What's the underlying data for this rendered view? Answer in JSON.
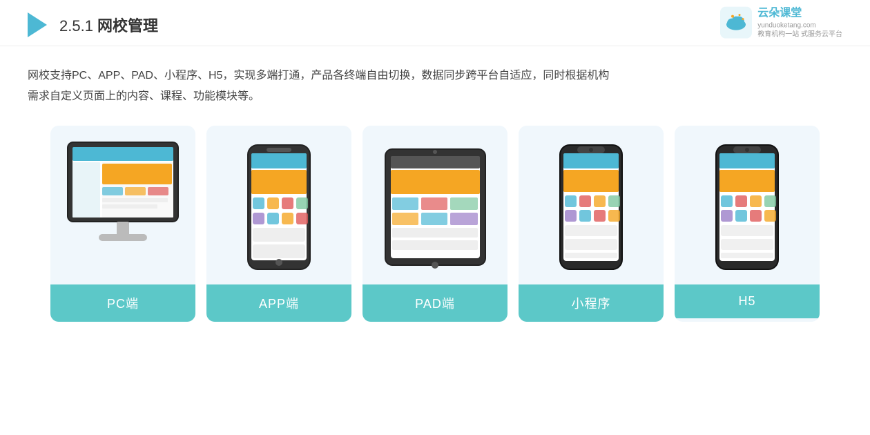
{
  "header": {
    "section_number": "2.5.1",
    "title_prefix": "2.5.1 ",
    "title_bold": "网校管理"
  },
  "brand": {
    "name": "云朵课堂",
    "url": "yunduoketang.com",
    "slogan_line1": "教育机构一站",
    "slogan_line2": "式服务云平台"
  },
  "description": {
    "text_line1": "网校支持PC、APP、PAD、小程序、H5，实现多端打通，产品各终端自由切换，数据同步跨平台自适应，同时根据机构",
    "text_line2": "需求自定义页面上的内容、课程、功能模块等。"
  },
  "cards": [
    {
      "id": "pc",
      "label": "PC端",
      "device_type": "monitor"
    },
    {
      "id": "app",
      "label": "APP端",
      "device_type": "phone"
    },
    {
      "id": "pad",
      "label": "PAD端",
      "device_type": "tablet"
    },
    {
      "id": "miniapp",
      "label": "小程序",
      "device_type": "phone2"
    },
    {
      "id": "h5",
      "label": "H5",
      "device_type": "phone3"
    }
  ]
}
